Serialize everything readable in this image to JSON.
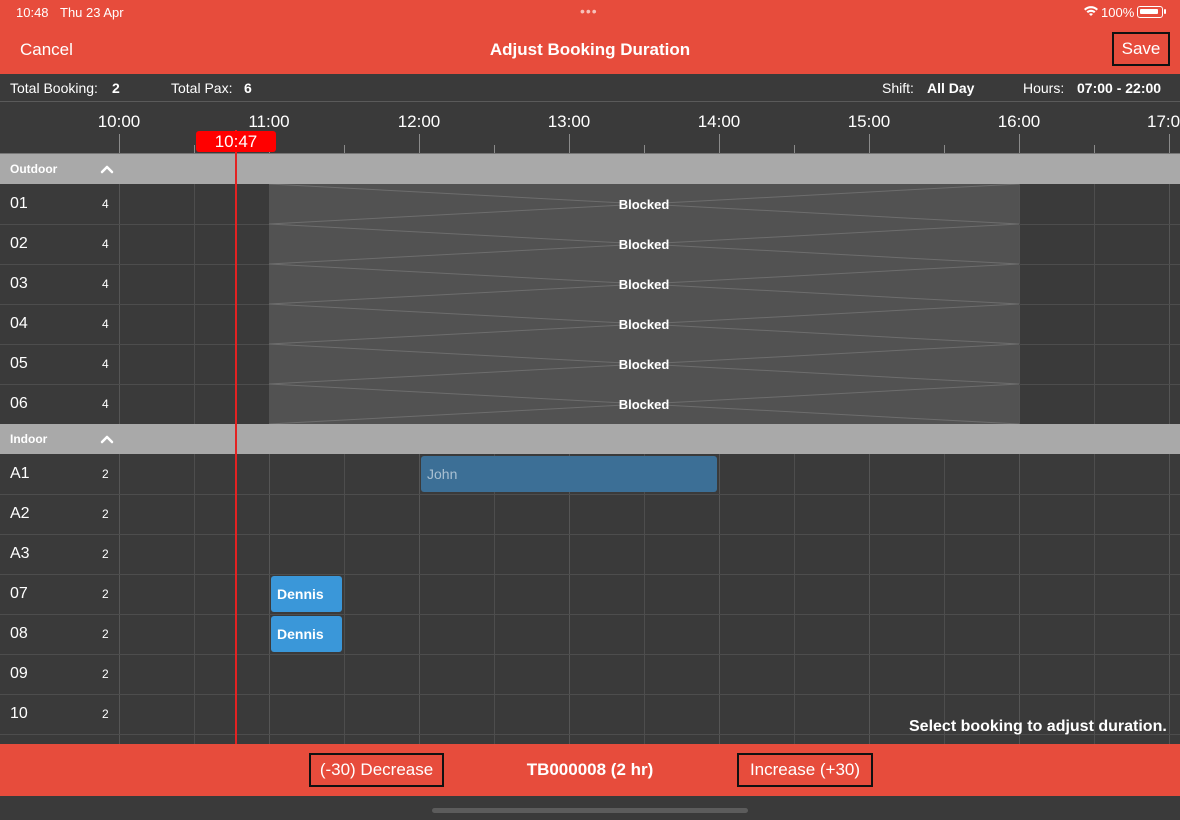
{
  "status": {
    "time": "10:48",
    "date": "Thu 23 Apr",
    "battery": "100%"
  },
  "nav": {
    "cancel": "Cancel",
    "title": "Adjust Booking Duration",
    "save": "Save"
  },
  "summary": {
    "total_booking_label": "Total Booking:",
    "total_booking_value": "2",
    "total_pax_label": "Total Pax:",
    "total_pax_value": "6",
    "shift_label": "Shift:",
    "shift_value": "All Day",
    "hours_label": "Hours:",
    "hours_value": "07:00 - 22:00"
  },
  "timeline": {
    "hours": [
      "10:00",
      "11:00",
      "12:00",
      "13:00",
      "14:00",
      "15:00",
      "16:00",
      "17:0"
    ],
    "now_label": "10:47"
  },
  "sections": [
    {
      "name": "Outdoor",
      "rows": [
        {
          "table": "01",
          "pax": "4"
        },
        {
          "table": "02",
          "pax": "4"
        },
        {
          "table": "03",
          "pax": "4"
        },
        {
          "table": "04",
          "pax": "4"
        },
        {
          "table": "05",
          "pax": "4"
        },
        {
          "table": "06",
          "pax": "4"
        }
      ],
      "blocked_label": "Blocked"
    },
    {
      "name": "Indoor",
      "rows": [
        {
          "table": "A1",
          "pax": "2"
        },
        {
          "table": "A2",
          "pax": "2"
        },
        {
          "table": "A3",
          "pax": "2"
        },
        {
          "table": "07",
          "pax": "2"
        },
        {
          "table": "08",
          "pax": "2"
        },
        {
          "table": "09",
          "pax": "2"
        },
        {
          "table": "10",
          "pax": "2"
        }
      ]
    }
  ],
  "bookings": [
    {
      "table": "A1",
      "name": "John",
      "start": "12:00",
      "end": "14:00",
      "color": "#3c6f96"
    },
    {
      "table": "07",
      "name": "Dennis",
      "start": "11:00",
      "end": "11:30",
      "color": "#3a97d9"
    },
    {
      "table": "08",
      "name": "Dennis",
      "start": "11:00",
      "end": "11:30",
      "color": "#3a97d9"
    }
  ],
  "hint": "Select booking to adjust duration.",
  "bottom": {
    "decrease": "(-30) Decrease",
    "reference": "TB000008 (2 hr)",
    "increase": "Increase (+30)"
  },
  "colors": {
    "accent": "#e74c3c",
    "now_line": "#e32222",
    "section": "#a9a9a9"
  }
}
